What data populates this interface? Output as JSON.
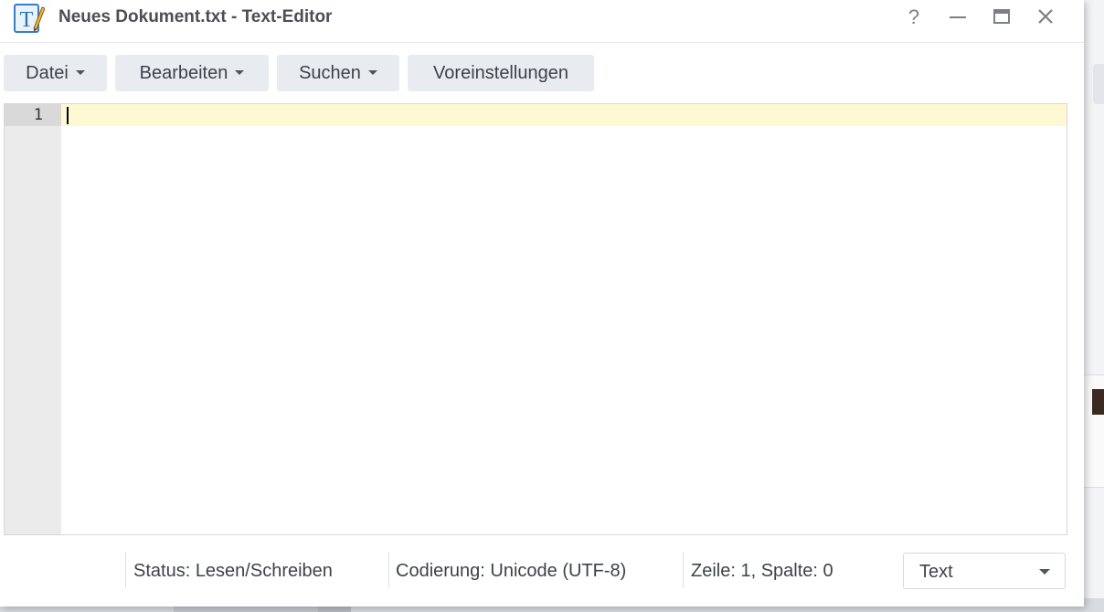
{
  "window": {
    "title": "Neues Dokument.txt - Text-Editor",
    "app_icon": "text-editor-icon",
    "controls": {
      "help": "?",
      "minimize_icon": "minimize-icon",
      "maximize_icon": "maximize-icon",
      "close_icon": "close-icon"
    }
  },
  "toolbar": {
    "file_label": "Datei",
    "edit_label": "Bearbeiten",
    "search_label": "Suchen",
    "settings_label": "Voreinstellungen"
  },
  "editor": {
    "line_numbers": [
      "1"
    ],
    "content": "",
    "active_line_color": "#fef9d3"
  },
  "status": {
    "status_text": "Status: Lesen/Schreiben",
    "encoding_text": "Codierung: Unicode (UTF-8)",
    "position_text": "Zeile: 1, Spalte: 0",
    "mode_value": "Text"
  },
  "colors": {
    "toolbar_button_bg": "#e8ecf1",
    "gutter_bg": "#ebebeb"
  }
}
